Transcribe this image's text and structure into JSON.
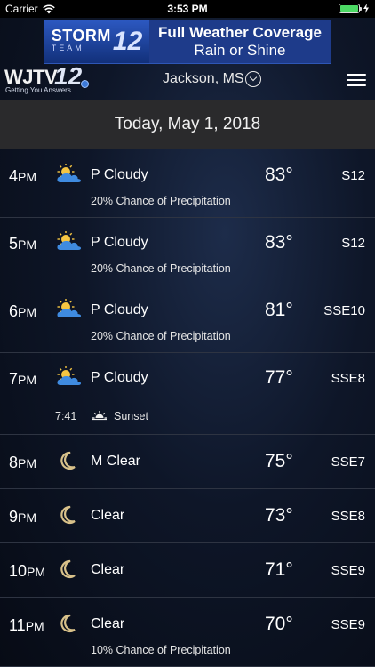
{
  "status_bar": {
    "carrier": "Carrier",
    "time": "3:53 PM"
  },
  "banner": {
    "logo_word": "STORM",
    "logo_sub": "TEAM",
    "logo_number": "12",
    "line1": "Full Weather Coverage",
    "line2": "Rain or Shine"
  },
  "header": {
    "brand_call": "WJTV",
    "brand_number": "12",
    "brand_tagline": "Getting You Answers",
    "location": "Jackson, MS"
  },
  "date_label": "Today, May 1, 2018",
  "hours": [
    {
      "hour": "4",
      "ampm": "PM",
      "icon": "partly-cloudy-icon",
      "condition": "P Cloudy",
      "temp": "83°",
      "wind": "S12",
      "precip": "20% Chance of Precipitation"
    },
    {
      "hour": "5",
      "ampm": "PM",
      "icon": "partly-cloudy-icon",
      "condition": "P Cloudy",
      "temp": "83°",
      "wind": "S12",
      "precip": "20% Chance of Precipitation"
    },
    {
      "hour": "6",
      "ampm": "PM",
      "icon": "partly-cloudy-icon",
      "condition": "P Cloudy",
      "temp": "81°",
      "wind": "SSE10",
      "precip": "20% Chance of Precipitation"
    },
    {
      "hour": "7",
      "ampm": "PM",
      "icon": "partly-cloudy-icon",
      "condition": "P Cloudy",
      "temp": "77°",
      "wind": "SSE8",
      "sunset_time": "7:41",
      "sunset_label": "Sunset"
    },
    {
      "hour": "8",
      "ampm": "PM",
      "icon": "moon-icon",
      "condition": "M Clear",
      "temp": "75°",
      "wind": "SSE7"
    },
    {
      "hour": "9",
      "ampm": "PM",
      "icon": "moon-icon",
      "condition": "Clear",
      "temp": "73°",
      "wind": "SSE8"
    },
    {
      "hour": "10",
      "ampm": "PM",
      "icon": "moon-icon",
      "condition": "Clear",
      "temp": "71°",
      "wind": "SSE9"
    },
    {
      "hour": "11",
      "ampm": "PM",
      "icon": "moon-icon",
      "condition": "Clear",
      "temp": "70°",
      "wind": "SSE9",
      "precip": "10% Chance of Precipitation"
    }
  ],
  "colors": {
    "background": "#0e1628",
    "date_bar": "#2a2a2c",
    "battery": "#4cd964",
    "banner": "#1e3b8a",
    "moon": "#d8c18a",
    "sun": "#f5c542"
  }
}
